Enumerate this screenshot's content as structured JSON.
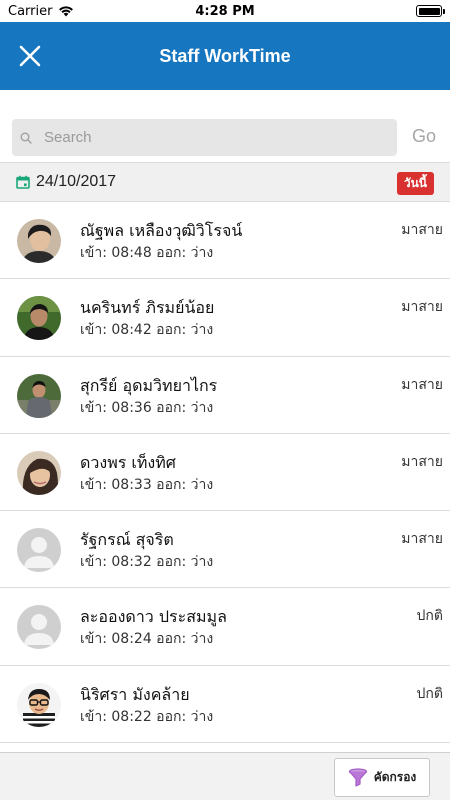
{
  "status_bar": {
    "carrier": "Carrier",
    "time": "4:28 PM",
    "battery_level": 1.0
  },
  "header": {
    "title": "Staff WorkTime"
  },
  "search": {
    "placeholder": "Search",
    "value": "",
    "go_label": "Go"
  },
  "date_bar": {
    "date": "24/10/2017",
    "today_label": "วันนี้"
  },
  "staff": [
    {
      "name": "ณัฐพล เหลืองวุฒิวิโรจน์",
      "time": "เข้า: 08:48 ออก: ว่าง",
      "status": "มาสาย",
      "avatar": "photo-man-dark-hair"
    },
    {
      "name": "นครินทร์ ภิรมย์น้อย",
      "time": "เข้า: 08:42 ออก: ว่าง",
      "status": "มาสาย",
      "avatar": "photo-man-green-bg"
    },
    {
      "name": "สุกรีย์ อุดมวิทยาไกร",
      "time": "เข้า: 08:36 ออก: ว่าง",
      "status": "มาสาย",
      "avatar": "photo-man-outdoor"
    },
    {
      "name": "ดวงพร เท็งทิศ",
      "time": "เข้า: 08:33 ออก: ว่าง",
      "status": "มาสาย",
      "avatar": "photo-woman"
    },
    {
      "name": "รัฐกรณ์ สุจริต",
      "time": "เข้า: 08:32 ออก: ว่าง",
      "status": "มาสาย",
      "avatar": "default-avatar-icon"
    },
    {
      "name": "ละอองดาว ประสมมูล",
      "time": "เข้า: 08:24 ออก: ว่าง",
      "status": "ปกติ",
      "avatar": "default-avatar-icon"
    },
    {
      "name": "นิริศรา มังคล้าย",
      "time": "เข้า: 08:22 ออก: ว่าง",
      "status": "ปกติ",
      "avatar": "cartoon-avatar"
    }
  ],
  "footer": {
    "filter_label": "คัดกรอง"
  },
  "colors": {
    "nav": "#1676c0",
    "badge": "#d9312f",
    "date_icon": "#1aa87a",
    "filter_icon": "#a65ac8"
  }
}
